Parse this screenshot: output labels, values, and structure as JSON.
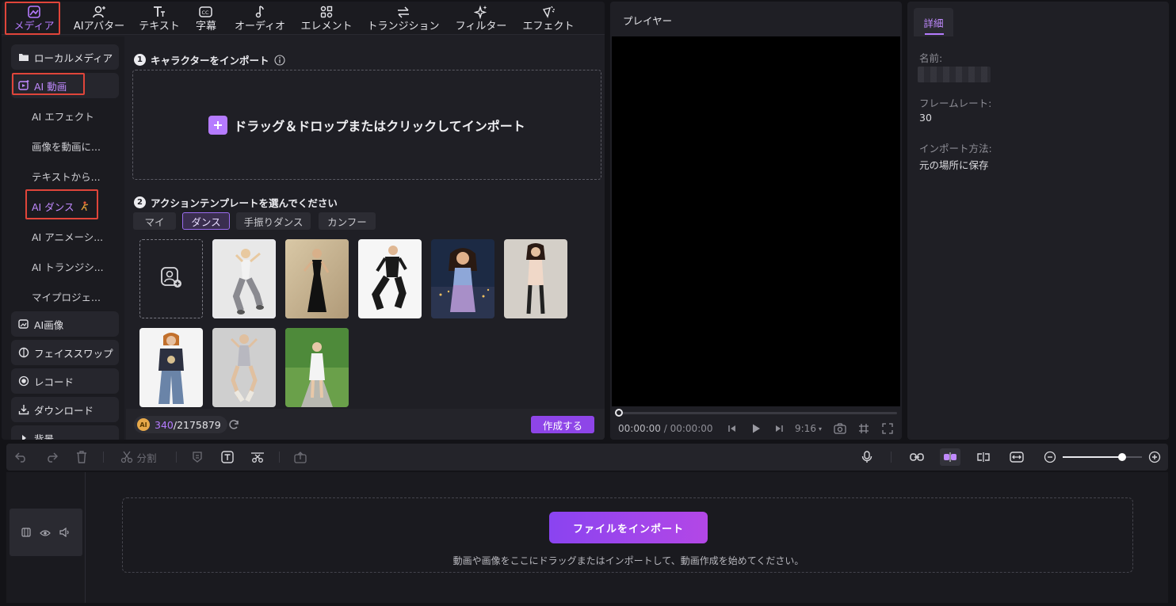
{
  "toolbar": {
    "items": [
      {
        "label": "メディア",
        "icon": "media-icon",
        "active": true
      },
      {
        "label": "AIアバター",
        "icon": "avatar-icon"
      },
      {
        "label": "テキスト",
        "icon": "text-icon"
      },
      {
        "label": "字幕",
        "icon": "caption-icon"
      },
      {
        "label": "オーディオ",
        "icon": "music-note-icon"
      },
      {
        "label": "エレメント",
        "icon": "elements-icon"
      },
      {
        "label": "トランジション",
        "icon": "transition-icon"
      },
      {
        "label": "フィルター",
        "icon": "sparkle-icon"
      },
      {
        "label": "エフェクト",
        "icon": "effect-icon"
      }
    ]
  },
  "sidebar": {
    "local_media": "ローカルメディア",
    "ai_video": "AI 動画",
    "subs": [
      "AI エフェクト",
      "画像を動画に...",
      "テキストから...",
      "AI ダンス",
      "AI アニメーシ...",
      "AI トランジシ...",
      "マイプロジェ..."
    ],
    "ai_image": "AI画像",
    "face_swap": "フェイススワップ",
    "record": "レコード",
    "download": "ダウンロード",
    "background": "背景"
  },
  "content": {
    "step1": {
      "num": "1",
      "text": "キャラクターをインポート"
    },
    "dropzone_text": "ドラッグ＆ドロップまたはクリックしてインポート",
    "step2": {
      "num": "2",
      "text": "アクションテンプレートを選んでください"
    },
    "tabs": [
      "マイ",
      "ダンス",
      "手振りダンス",
      "カンフー"
    ],
    "active_tab": "ダンス",
    "credits_used": "340",
    "credits_total": "/2175879",
    "coin_label": "AI",
    "create_button": "作成する"
  },
  "player": {
    "title": "プレイヤー",
    "time_current": "00:00:00",
    "time_separator": "/",
    "time_total": "00:00:00",
    "aspect": "9:16"
  },
  "details": {
    "tab": "詳細",
    "name_label": "名前:",
    "framerate_label": "フレームレート:",
    "framerate_value": "30",
    "import_label": "インポート方法:",
    "import_value": "元の場所に保存"
  },
  "timeline": {
    "split_label": "分割",
    "import_button": "ファイルをインポート",
    "hint": "動画や画像をここにドラッグまたはインポートして、動画作成を始めてください。",
    "zoom_level": 0.75
  },
  "colors": {
    "accent": "#b57bff",
    "button": "#8e45e8",
    "highlight_frame": "#e0453a"
  }
}
